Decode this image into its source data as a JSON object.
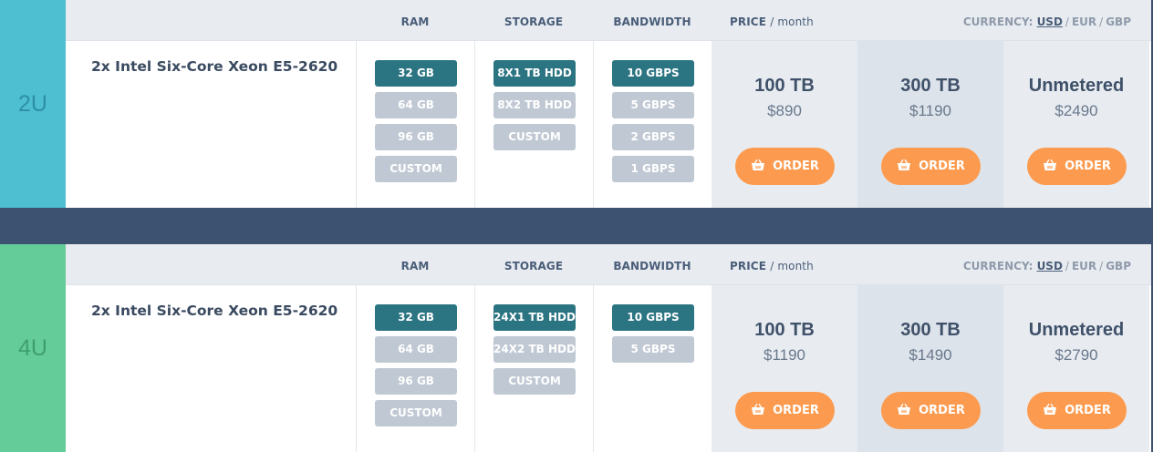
{
  "plans": [
    {
      "size": "2U",
      "cpu": "2x Intel Six-Core Xeon E5-2620",
      "headers": {
        "ram": "RAM",
        "storage": "STORAGE",
        "bandwidth": "BANDWIDTH",
        "price": "PRICE",
        "price_unit": "/ month",
        "currency_label": "CURRENCY:",
        "currency_usd": "USD",
        "currency_eur": "EUR",
        "currency_gbp": "GBP",
        "sep": "/"
      },
      "ram": [
        {
          "label": "32 GB",
          "selected": true
        },
        {
          "label": "64 GB",
          "selected": false
        },
        {
          "label": "96 GB",
          "selected": false
        },
        {
          "label": "CUSTOM",
          "selected": false
        }
      ],
      "storage": [
        {
          "label": "8x1 TB HDD",
          "selected": true
        },
        {
          "label": "8x2 TB HDD",
          "selected": false
        },
        {
          "label": "CUSTOM",
          "selected": false
        }
      ],
      "bandwidth": [
        {
          "label": "10 GBPS",
          "selected": true
        },
        {
          "label": "5 GBPS",
          "selected": false
        },
        {
          "label": "2 GBPS",
          "selected": false
        },
        {
          "label": "1 GBPS",
          "selected": false
        }
      ],
      "prices": [
        {
          "traffic": "100 TB",
          "amount": "$890",
          "order": "ORDER"
        },
        {
          "traffic": "300 TB",
          "amount": "$1190",
          "order": "ORDER"
        },
        {
          "traffic": "Unmetered",
          "amount": "$2490",
          "order": "ORDER"
        }
      ]
    },
    {
      "size": "4U",
      "cpu": "2x Intel Six-Core Xeon E5-2620",
      "headers": {
        "ram": "RAM",
        "storage": "STORAGE",
        "bandwidth": "BANDWIDTH",
        "price": "PRICE",
        "price_unit": "/ month",
        "currency_label": "CURRENCY:",
        "currency_usd": "USD",
        "currency_eur": "EUR",
        "currency_gbp": "GBP",
        "sep": "/"
      },
      "ram": [
        {
          "label": "32 GB",
          "selected": true
        },
        {
          "label": "64 GB",
          "selected": false
        },
        {
          "label": "96 GB",
          "selected": false
        },
        {
          "label": "CUSTOM",
          "selected": false
        }
      ],
      "storage": [
        {
          "label": "24x1 TB HDD",
          "selected": true
        },
        {
          "label": "24x2 TB HDD",
          "selected": false
        },
        {
          "label": "CUSTOM",
          "selected": false
        }
      ],
      "bandwidth": [
        {
          "label": "10 GBPS",
          "selected": true
        },
        {
          "label": "5 GBPS",
          "selected": false
        }
      ],
      "prices": [
        {
          "traffic": "100 TB",
          "amount": "$1190",
          "order": "ORDER"
        },
        {
          "traffic": "300 TB",
          "amount": "$1490",
          "order": "ORDER"
        },
        {
          "traffic": "Unmetered",
          "amount": "$2790",
          "order": "ORDER"
        }
      ]
    }
  ],
  "colors": {
    "selected_option": "#2b7482",
    "unselected_option": "#bfc8d3",
    "order_button": "#fc9b4f",
    "tag_2u": "#4dbfd0",
    "tag_4u": "#64cc99",
    "divider": "#3d5170"
  },
  "icons": {
    "order": "basket-icon"
  }
}
